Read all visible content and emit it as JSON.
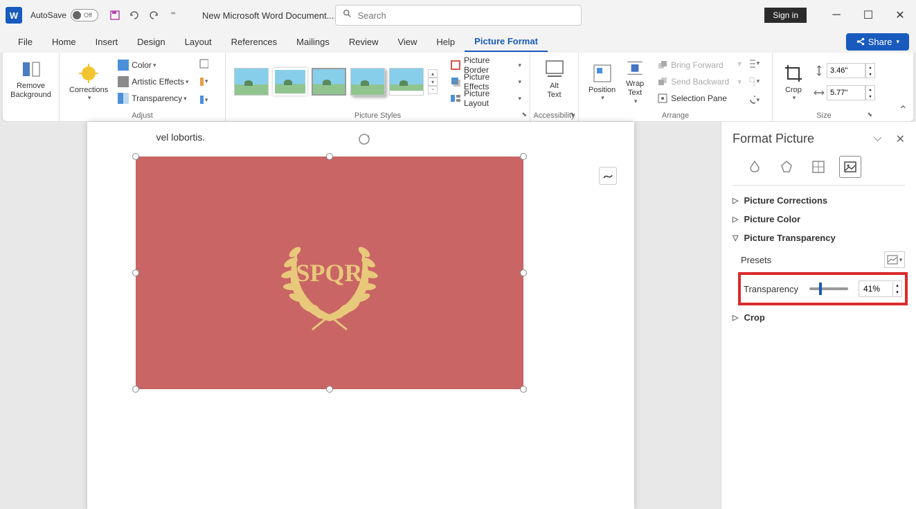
{
  "titlebar": {
    "autosave_label": "AutoSave",
    "autosave_state": "Off",
    "doc_title": "New Microsoft Word Document....",
    "search_placeholder": "Search",
    "signin": "Sign in"
  },
  "tabs": {
    "file": "File",
    "home": "Home",
    "insert": "Insert",
    "design": "Design",
    "layout": "Layout",
    "references": "References",
    "mailings": "Mailings",
    "review": "Review",
    "view": "View",
    "help": "Help",
    "picture_format": "Picture Format",
    "share": "Share"
  },
  "ribbon": {
    "remove_bg": "Remove\nBackground",
    "corrections": "Corrections",
    "color": "Color",
    "artistic": "Artistic Effects",
    "transparency": "Transparency",
    "adjust_label": "Adjust",
    "picture_styles_label": "Picture Styles",
    "border": "Picture Border",
    "effects": "Picture Effects",
    "layout": "Picture Layout",
    "alt_text": "Alt\nText",
    "accessibility_label": "Accessibility",
    "position": "Position",
    "wrap": "Wrap\nText",
    "bring_fwd": "Bring Forward",
    "send_back": "Send Backward",
    "selection": "Selection Pane",
    "arrange_label": "Arrange",
    "crop": "Crop",
    "height": "3.46\"",
    "width": "5.77\"",
    "size_label": "Size"
  },
  "document": {
    "text_line": "vel lobortis.",
    "image_text": "SPQR"
  },
  "pane": {
    "title": "Format Picture",
    "corrections": "Picture Corrections",
    "color": "Picture Color",
    "transparency_section": "Picture Transparency",
    "presets": "Presets",
    "transparency_label": "Transparency",
    "transparency_value": "41%",
    "crop": "Crop"
  }
}
